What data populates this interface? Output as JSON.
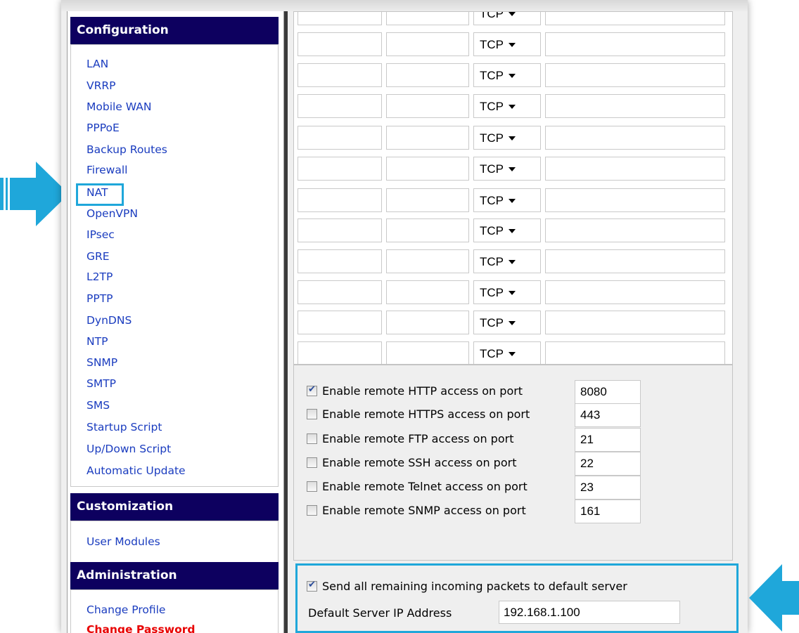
{
  "colors": {
    "section_header_bg": "#0d005f",
    "nav_link": "#1a3cbf",
    "nav_link_active": "#e80000",
    "highlight": "#1fa7da"
  },
  "sidebar": {
    "configuration": {
      "title": "Configuration",
      "items": [
        {
          "label": "LAN"
        },
        {
          "label": "VRRP"
        },
        {
          "label": "Mobile WAN"
        },
        {
          "label": "PPPoE"
        },
        {
          "label": "Backup Routes"
        },
        {
          "label": "Firewall"
        },
        {
          "label": "NAT"
        },
        {
          "label": "OpenVPN"
        },
        {
          "label": "IPsec"
        },
        {
          "label": "GRE"
        },
        {
          "label": "L2TP"
        },
        {
          "label": "PPTP"
        },
        {
          "label": "DynDNS"
        },
        {
          "label": "NTP"
        },
        {
          "label": "SNMP"
        },
        {
          "label": "SMTP"
        },
        {
          "label": "SMS"
        },
        {
          "label": "Startup Script"
        },
        {
          "label": "Up/Down Script"
        },
        {
          "label": "Automatic Update"
        }
      ]
    },
    "customization": {
      "title": "Customization",
      "items": [
        {
          "label": "User Modules"
        }
      ]
    },
    "administration": {
      "title": "Administration",
      "items": [
        {
          "label": "Change Profile"
        },
        {
          "label": "Change Password"
        }
      ]
    }
  },
  "nat_table": {
    "rows": [
      {
        "protocol": "TCP"
      },
      {
        "protocol": "TCP"
      },
      {
        "protocol": "TCP"
      },
      {
        "protocol": "TCP"
      },
      {
        "protocol": "TCP"
      },
      {
        "protocol": "TCP"
      },
      {
        "protocol": "TCP"
      },
      {
        "protocol": "TCP"
      },
      {
        "protocol": "TCP"
      },
      {
        "protocol": "TCP"
      },
      {
        "protocol": "TCP"
      },
      {
        "protocol": "TCP"
      }
    ]
  },
  "remote_access": [
    {
      "label": "Enable remote HTTP access on port",
      "checked": true,
      "port": "8080"
    },
    {
      "label": "Enable remote HTTPS access on port",
      "checked": false,
      "port": "443"
    },
    {
      "label": "Enable remote FTP access on port",
      "checked": false,
      "port": "21"
    },
    {
      "label": "Enable remote SSH access on port",
      "checked": false,
      "port": "22"
    },
    {
      "label": "Enable remote Telnet access on port",
      "checked": false,
      "port": "23"
    },
    {
      "label": "Enable remote SNMP access on port",
      "checked": false,
      "port": "161"
    }
  ],
  "default_server": {
    "checkbox_label": "Send all remaining incoming packets to default server",
    "checked": true,
    "ip_label": "Default Server IP Address",
    "ip_value": "192.168.1.100"
  },
  "callouts": [
    {
      "icon": "arrow-right-icon",
      "target": "NAT"
    },
    {
      "icon": "arrow-left-icon",
      "target": "default server"
    }
  ]
}
